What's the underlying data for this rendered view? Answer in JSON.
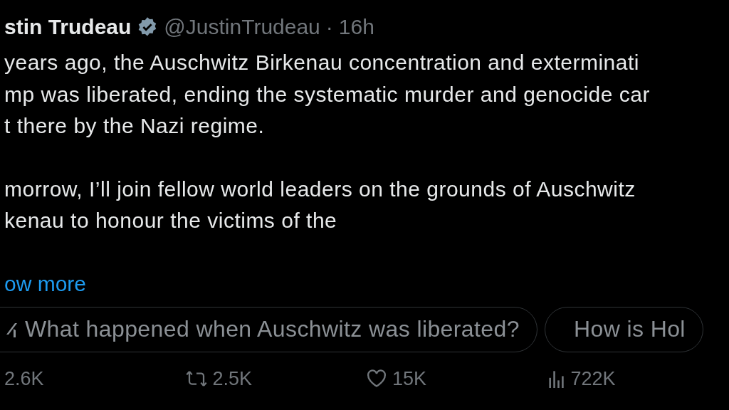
{
  "author": {
    "name": "stin Trudeau",
    "handle": "@JustinTrudeau",
    "separator": "·",
    "time": "16h"
  },
  "paragraphs": [
    [
      "years ago, the Auschwitz Birkenau concentration and exterminati",
      "mp was liberated, ending the systematic murder and genocide car",
      "t there by the Nazi regime."
    ],
    [
      "morrow, I’ll join fellow world leaders on the grounds of Auschwitz",
      "kenau to honour the victims of the"
    ]
  ],
  "show_more": "ow more",
  "suggestions": [
    {
      "kind": "grok",
      "text": "What happened when Auschwitz was liberated?"
    },
    {
      "kind": "plain",
      "text": "How is Hol"
    }
  ],
  "actions": [
    {
      "kind": "reply",
      "count": "2.6K"
    },
    {
      "kind": "repost",
      "count": "2.5K"
    },
    {
      "kind": "like",
      "count": "15K"
    },
    {
      "kind": "views",
      "count": "722K"
    }
  ]
}
